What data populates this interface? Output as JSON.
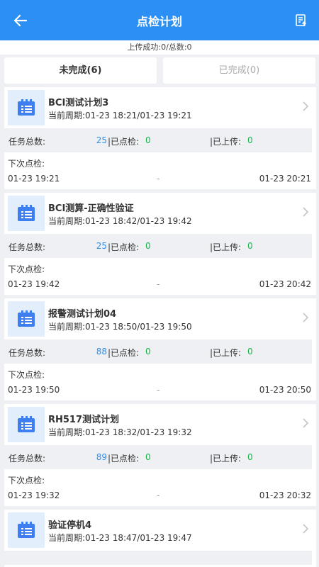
{
  "header": {
    "title": "点检计划"
  },
  "status": {
    "text": "上传成功:0/总数:0"
  },
  "tabs": [
    {
      "label": "未完成(6)"
    },
    {
      "label": "已完成(0)"
    }
  ],
  "labels": {
    "total": "任务总数:",
    "checked": "|已点检:",
    "uploaded": "|已上传:",
    "next": "下次点检:",
    "dash": "-"
  },
  "plans": [
    {
      "name": "BCI测试计划3",
      "period": "当前周期:01-23 18:21/01-23 19:21",
      "total": "25",
      "checked": "0",
      "uploaded": "0",
      "next_start": "01-23 19:21",
      "next_end": "01-23 20:21"
    },
    {
      "name": "BCI测算-正确性验证",
      "period": "当前周期:01-23 18:42/01-23 19:42",
      "total": "25",
      "checked": "0",
      "uploaded": "0",
      "next_start": "01-23 19:42",
      "next_end": "01-23 20:42"
    },
    {
      "name": "报警测试计划04",
      "period": "当前周期:01-23 18:50/01-23 19:50",
      "total": "88",
      "checked": "0",
      "uploaded": "0",
      "next_start": "01-23 19:50",
      "next_end": "01-23 20:50"
    },
    {
      "name": "RH517测试计划",
      "period": "当前周期:01-23 18:32/01-23 19:32",
      "total": "89",
      "checked": "0",
      "uploaded": "0",
      "next_start": "01-23 19:32",
      "next_end": "01-23 20:32"
    },
    {
      "name": "验证停机4",
      "period": "当前周期:01-23 18:47/01-23 19:47"
    }
  ],
  "colors": {
    "primary": "#2b8ff3",
    "green": "#19b34a",
    "icon_bg": "#e3eefc"
  },
  "icons": {
    "back": "arrow-left-icon",
    "upload": "upload-list-icon",
    "plan": "clipboard-list-icon",
    "chevron": "chevron-right-icon"
  }
}
